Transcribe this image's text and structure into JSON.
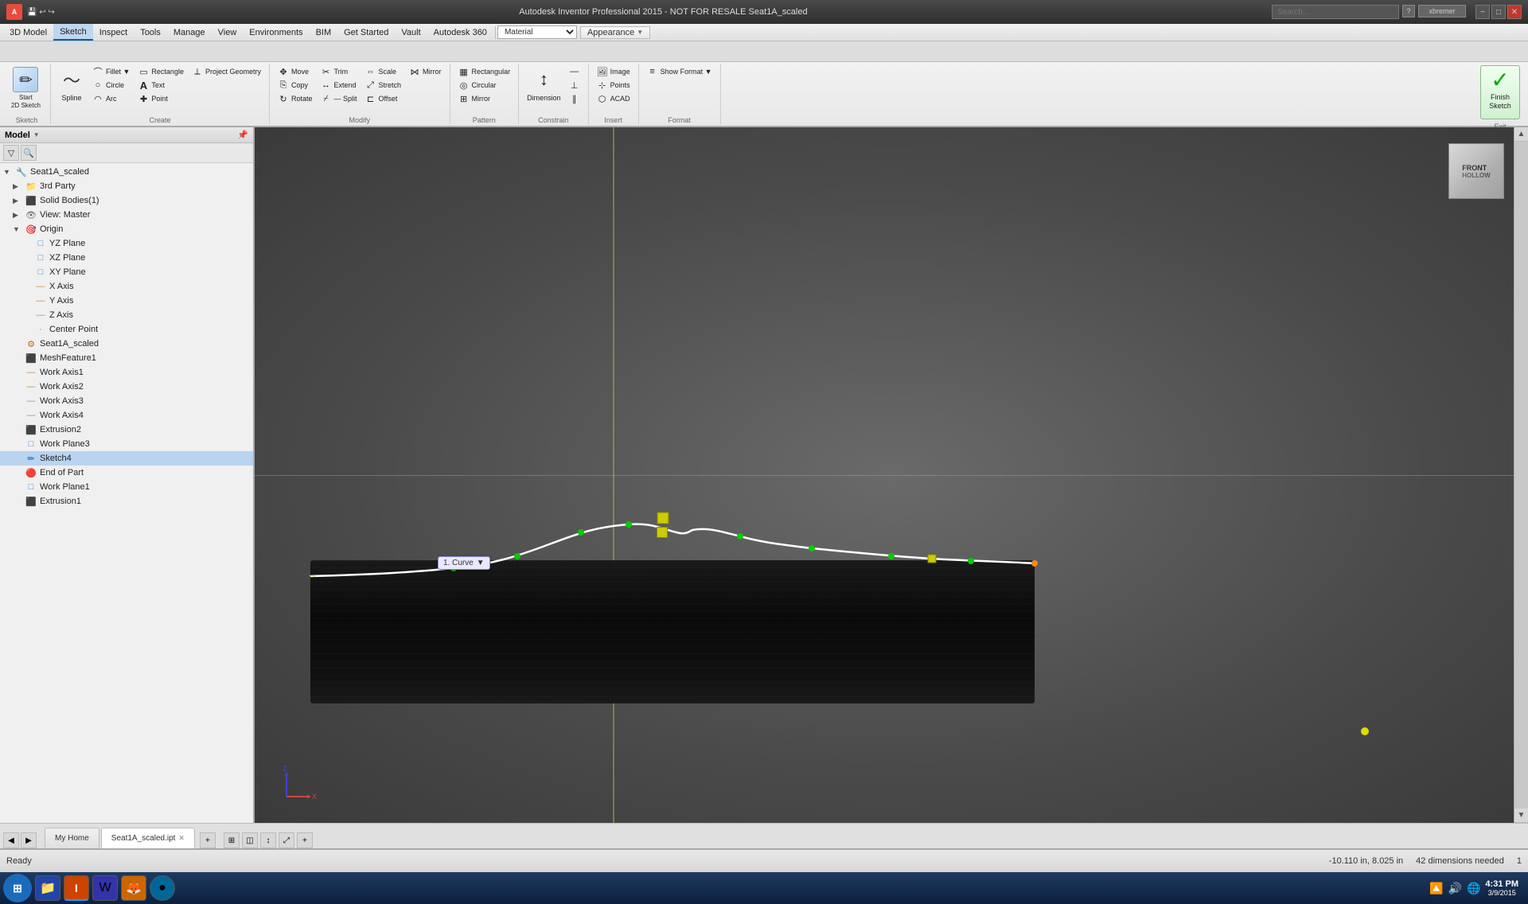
{
  "titlebar": {
    "app_name": "Autodesk Inventor Professional 2015 - NOT FOR RESALE",
    "file_name": "Seat1A_scaled",
    "full_title": "Autodesk Inventor Professional 2015 - NOT FOR RESALE    Seat1A_scaled",
    "search_placeholder": "Search...",
    "min_label": "−",
    "max_label": "□",
    "close_label": "✕",
    "user_label": "xbremer"
  },
  "menubar": {
    "items": [
      {
        "label": "3D Model"
      },
      {
        "label": "Sketch",
        "active": true
      },
      {
        "label": "Inspect"
      },
      {
        "label": "Tools"
      },
      {
        "label": "Manage"
      },
      {
        "label": "View"
      },
      {
        "label": "Environments"
      },
      {
        "label": "BIM"
      },
      {
        "label": "Get Started"
      },
      {
        "label": "Vault"
      },
      {
        "label": "Autodesk 360",
        "has_arrow": true
      }
    ],
    "material_value": "Material",
    "appearance_label": "Appearance",
    "appearance_arrow": "▼"
  },
  "ribbon": {
    "sketch_group": {
      "label": "Sketch",
      "start_2d_label": "Start\n2D Sketch",
      "start_2d_icon": "✏"
    },
    "create_group": {
      "label": "Create",
      "items": [
        {
          "label": "Spline",
          "icon": "〜"
        },
        {
          "label": "Circle",
          "icon": "○"
        },
        {
          "label": "Arc",
          "icon": "◠"
        },
        {
          "label": "Rectangle",
          "icon": "▭"
        },
        {
          "label": "Fillet",
          "icon": "⌒"
        },
        {
          "label": "Text",
          "icon": "A"
        },
        {
          "label": "Point",
          "icon": "·"
        },
        {
          "label": "Project Geometry",
          "icon": "⟂"
        }
      ]
    },
    "modify_group": {
      "label": "Modify",
      "items": [
        {
          "label": "Move",
          "icon": "✥"
        },
        {
          "label": "Trim",
          "icon": "✂"
        },
        {
          "label": "Scale",
          "icon": "⇔"
        },
        {
          "label": "Copy",
          "icon": "⎘"
        },
        {
          "label": "Extend",
          "icon": "↔"
        },
        {
          "label": "Stretch",
          "icon": "⤢"
        },
        {
          "label": "Rotate",
          "icon": "↻"
        },
        {
          "label": "Split",
          "icon": "⌿"
        },
        {
          "label": "Offset",
          "icon": "⊏"
        },
        {
          "label": "Mirror",
          "icon": "⋈"
        }
      ]
    },
    "pattern_group": {
      "label": "Pattern",
      "items": [
        {
          "label": "Rectangular",
          "icon": "▦"
        },
        {
          "label": "Circular",
          "icon": "◎"
        },
        {
          "label": "Mirror",
          "icon": "⊞"
        }
      ]
    },
    "constrain_group": {
      "label": "Constrain",
      "items": [
        {
          "label": "Dimension",
          "icon": "↕"
        }
      ]
    },
    "insert_group": {
      "label": "Insert",
      "items": [
        {
          "label": "Image",
          "icon": "🖼"
        },
        {
          "label": "Points",
          "icon": "⊹"
        },
        {
          "label": "ACAD",
          "icon": "⬡"
        }
      ]
    },
    "format_group": {
      "label": "Format",
      "items": [
        {
          "label": "Show Format",
          "icon": "≡",
          "has_arrow": true
        }
      ]
    },
    "exit_group": {
      "label": "Exit",
      "finish_label": "Finish\nSketch",
      "finish_icon": "✓"
    }
  },
  "panel": {
    "title": "Model",
    "expand_icon": "▼",
    "pin_icon": "📌",
    "filter_icon": "▽",
    "search_icon": "🔍",
    "tree": [
      {
        "label": "Seat1A_scaled",
        "level": 0,
        "icon": "🔧",
        "expanded": true,
        "type": "root"
      },
      {
        "label": "3rd Party",
        "level": 1,
        "icon": "📁",
        "expanded": false,
        "type": "folder"
      },
      {
        "label": "Solid Bodies(1)",
        "level": 1,
        "icon": "⬛",
        "expanded": false,
        "type": "solid"
      },
      {
        "label": "View: Master",
        "level": 1,
        "icon": "👁",
        "expanded": false,
        "type": "view"
      },
      {
        "label": "Origin",
        "level": 1,
        "icon": "🎯",
        "expanded": true,
        "type": "origin"
      },
      {
        "label": "YZ Plane",
        "level": 2,
        "icon": "□",
        "type": "plane"
      },
      {
        "label": "XZ Plane",
        "level": 2,
        "icon": "□",
        "type": "plane"
      },
      {
        "label": "XY Plane",
        "level": 2,
        "icon": "□",
        "type": "plane"
      },
      {
        "label": "X Axis",
        "level": 2,
        "icon": "—",
        "type": "axis"
      },
      {
        "label": "Y Axis",
        "level": 2,
        "icon": "—",
        "type": "axis"
      },
      {
        "label": "Z Axis",
        "level": 2,
        "icon": "—",
        "type": "axis"
      },
      {
        "label": "Center Point",
        "level": 2,
        "icon": "·",
        "type": "point"
      },
      {
        "label": "Seat1A_scaled",
        "level": 1,
        "icon": "⚙",
        "type": "part"
      },
      {
        "label": "MeshFeature1",
        "level": 1,
        "icon": "⬛",
        "type": "mesh"
      },
      {
        "label": "Work Axis1",
        "level": 1,
        "icon": "—",
        "type": "axis"
      },
      {
        "label": "Work Axis2",
        "level": 1,
        "icon": "—",
        "type": "axis"
      },
      {
        "label": "Work Axis3",
        "level": 1,
        "icon": "—",
        "type": "axis"
      },
      {
        "label": "Work Axis4",
        "level": 1,
        "icon": "—",
        "type": "axis"
      },
      {
        "label": "Extrusion2",
        "level": 1,
        "icon": "⬛",
        "type": "extrusion"
      },
      {
        "label": "Work Plane3",
        "level": 1,
        "icon": "□",
        "type": "plane"
      },
      {
        "label": "Sketch4",
        "level": 1,
        "icon": "✏",
        "type": "sketch",
        "selected": true
      },
      {
        "label": "End of Part",
        "level": 1,
        "icon": "🔴",
        "type": "end"
      },
      {
        "label": "Work Plane1",
        "level": 1,
        "icon": "□",
        "type": "plane"
      },
      {
        "label": "Extrusion1",
        "level": 1,
        "icon": "⬛",
        "type": "extrusion"
      }
    ]
  },
  "viewport": {
    "curve_tooltip": "1. Curve",
    "nav_cube": {
      "top_label": "FRONT",
      "sub_label": "HOLLOW"
    }
  },
  "statusbar": {
    "status": "Ready",
    "coordinates": "-10.110 in, 8.025 in",
    "dimensions_needed": "42 dimensions needed",
    "page_num": "1"
  },
  "bottom_tabs": {
    "tabs": [
      {
        "label": "My Home",
        "closeable": false
      },
      {
        "label": "Seat1A_scaled.ipt",
        "closeable": true,
        "active": true
      }
    ],
    "add_icon": "+"
  },
  "taskbar": {
    "apps": [
      {
        "icon": "⊞",
        "label": "Start"
      },
      {
        "icon": "📁",
        "label": "Explorer"
      },
      {
        "icon": "🔶",
        "label": "Inventor",
        "active": true
      },
      {
        "icon": "📄",
        "label": "Word"
      },
      {
        "icon": "🦊",
        "label": "Firefox"
      },
      {
        "icon": "🔵",
        "label": "App"
      }
    ],
    "tray": {
      "time": "4:31 PM",
      "date": "3/9/2015"
    }
  }
}
